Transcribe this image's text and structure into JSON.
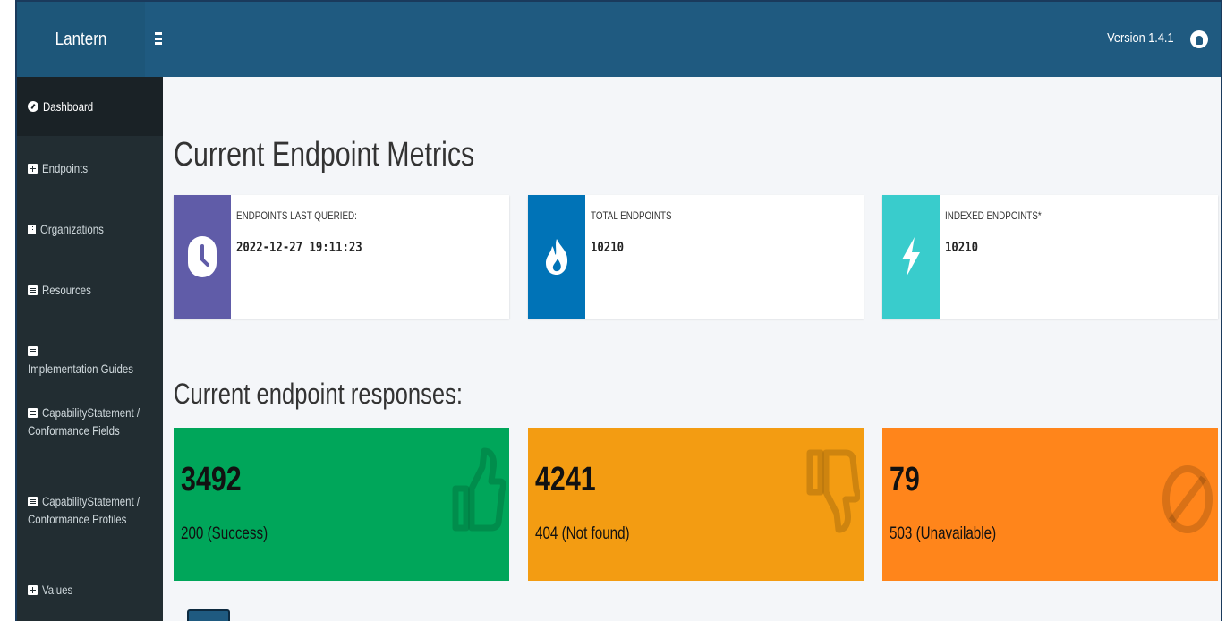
{
  "header": {
    "brand": "Lantern",
    "version": "Version 1.4.1"
  },
  "sidebar": {
    "items": [
      {
        "label": "Dashboard",
        "icon": "dashboard-icon"
      },
      {
        "label": "Endpoints",
        "icon": "table-icon"
      },
      {
        "label": "Organizations",
        "icon": "building-icon"
      },
      {
        "label": "Resources",
        "icon": "list-icon"
      },
      {
        "label": "Implementation Guides",
        "icon": "list-icon"
      },
      {
        "label_line1": "CapabilityStatement /",
        "label_line2": "Conformance Fields",
        "icon": "list-icon"
      },
      {
        "label_line1": "CapabilityStatement /",
        "label_line2": "Conformance Profiles",
        "icon": "list-icon"
      },
      {
        "label": "Values",
        "icon": "table-icon"
      }
    ]
  },
  "main": {
    "metrics_title": "Current Endpoint Metrics",
    "metrics": [
      {
        "label": "ENDPOINTS LAST QUERIED:",
        "value": "2022-12-27 19:11:23",
        "color": "#605ca8",
        "icon": "clock-icon"
      },
      {
        "label": "TOTAL ENDPOINTS",
        "value": "10210",
        "color": "#0073b7",
        "icon": "fire-icon"
      },
      {
        "label": "INDEXED ENDPOINTS*",
        "value": "10210",
        "color": "#39cccc",
        "icon": "bolt-icon"
      }
    ],
    "responses_title": "Current endpoint responses:",
    "responses": [
      {
        "count": "3492",
        "label": "200 (Success)",
        "color": "#00a65a",
        "icon": "thumbs-up-icon"
      },
      {
        "count": "4241",
        "label": "404 (Not found)",
        "color": "#f39c12",
        "icon": "thumbs-down-icon"
      },
      {
        "count": "79",
        "label": "503 (Unavailable)",
        "color": "#ff851b",
        "icon": "ban-icon"
      }
    ]
  }
}
